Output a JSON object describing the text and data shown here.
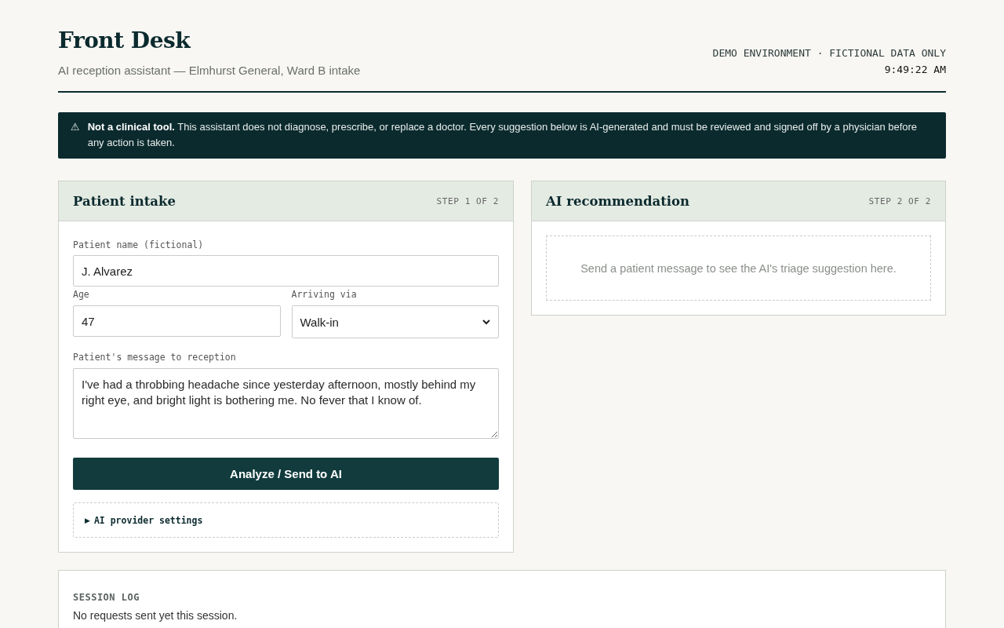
{
  "header": {
    "title": "Front Desk",
    "subtitle": "AI reception assistant — Elmhurst General, Ward B intake",
    "environment": "DEMO ENVIRONMENT · FICTIONAL DATA ONLY",
    "clock": "9:49:22 AM"
  },
  "notice": {
    "icon": "⚠",
    "text": "**Not a clinical tool.** This assistant does not diagnose, prescribe, or replace a doctor. Every suggestion below is AI-generated and must be reviewed and signed off by a physician before any action is taken."
  },
  "intake": {
    "title": "Patient intake",
    "step": "STEP 1 OF 2",
    "name": {
      "label": "Patient name (fictional)",
      "value": "J. Alvarez"
    },
    "age": {
      "label": "Age",
      "value": "47"
    },
    "arrival": {
      "label": "Arriving via",
      "value": "Walk-in"
    },
    "message": {
      "label": "Patient's message to reception",
      "value": "I've had a throbbing headache since yesterday afternoon, mostly behind my right eye, and bright light is bothering me. No fever that I know of."
    },
    "submit_button": "Analyze / Send to AI",
    "settings": {
      "marker": "▶",
      "label": "AI provider settings",
      "expanded": false
    }
  },
  "recommendation": {
    "title": "AI recommendation",
    "step": "STEP 2 OF 2",
    "empty_message": "Send a patient message to see the AI's triage suggestion here."
  },
  "session_log": {
    "title": "SESSION LOG",
    "empty_message": "No requests sent yet this session."
  }
}
